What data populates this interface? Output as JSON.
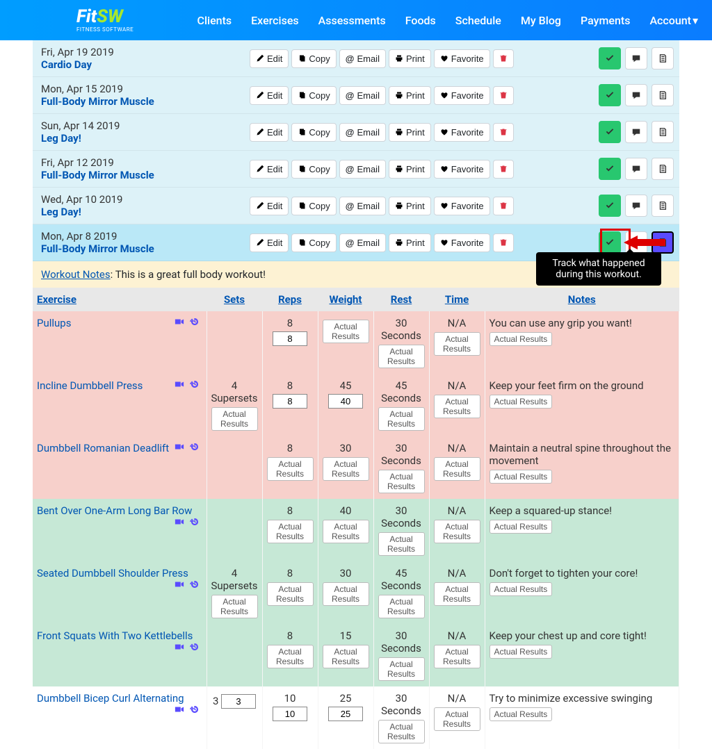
{
  "logo": {
    "fit": "Fit",
    "sw": "SW",
    "sub": "FITNESS SOFTWARE"
  },
  "nav": [
    "Clients",
    "Exercises",
    "Assessments",
    "Foods",
    "Schedule",
    "My Blog",
    "Payments",
    "Account"
  ],
  "actions": {
    "edit": "Edit",
    "copy": "Copy",
    "email": "Email",
    "print": "Print",
    "favorite": "Favorite",
    "actual_results": "Actual Results"
  },
  "tooltip": "Track what happened during this workout.",
  "workouts": [
    {
      "date": "Fri, Apr 19 2019",
      "name": "Cardio Day"
    },
    {
      "date": "Mon, Apr 15 2019",
      "name": "Full-Body Mirror Muscle"
    },
    {
      "date": "Sun, Apr 14 2019",
      "name": "Leg Day!"
    },
    {
      "date": "Fri, Apr 12 2019",
      "name": "Full-Body Mirror Muscle"
    },
    {
      "date": "Wed, Apr 10 2019",
      "name": "Leg Day!"
    },
    {
      "date": "Mon, Apr 8 2019",
      "name": "Full-Body Mirror Muscle"
    }
  ],
  "notes_label": "Workout Notes",
  "notes_text": ": This is a great full body workout!",
  "headers": {
    "exercise": "Exercise",
    "sets": "Sets",
    "reps": "Reps",
    "weight": "Weight",
    "rest": "Rest",
    "time": "Time",
    "notes": "Notes"
  },
  "exercises": [
    {
      "group": "pink",
      "name": "Pullups",
      "sets": "",
      "sets_sub": "",
      "sets_ar": false,
      "reps": "8",
      "reps_input": "8",
      "weight": "",
      "weight_input": "",
      "weight_ar": true,
      "rest": "30",
      "rest_sub": "Seconds",
      "time": "N/A",
      "notes": "You can use any grip you want!"
    },
    {
      "group": "pink",
      "name": "Incline Dumbbell Press",
      "sets": "4",
      "sets_sub": "Supersets",
      "sets_ar": true,
      "reps": "8",
      "reps_input": "8",
      "weight": "45",
      "weight_input": "40",
      "weight_ar": false,
      "rest": "45",
      "rest_sub": "Seconds",
      "time": "N/A",
      "notes": "Keep your feet firm on the ground"
    },
    {
      "group": "pink",
      "name": "Dumbbell Romanian Deadlift",
      "sets": "",
      "sets_sub": "",
      "sets_ar": false,
      "reps": "8",
      "reps_input": "",
      "reps_ar": true,
      "weight": "30",
      "weight_input": "",
      "weight_ar": true,
      "rest": "30",
      "rest_sub": "Seconds",
      "time": "N/A",
      "notes": "Maintain a neutral spine throughout the movement"
    },
    {
      "group": "green",
      "name": "Bent Over One-Arm Long Bar Row",
      "sets": "",
      "sets_sub": "",
      "sets_ar": false,
      "reps": "8",
      "reps_input": "",
      "reps_ar": true,
      "weight": "40",
      "weight_input": "",
      "weight_ar": true,
      "rest": "30",
      "rest_sub": "Seconds",
      "time": "N/A",
      "notes": "Keep a squared-up stance!"
    },
    {
      "group": "green",
      "name": "Seated Dumbbell Shoulder Press",
      "sets": "4",
      "sets_sub": "Supersets",
      "sets_ar": true,
      "reps": "8",
      "reps_input": "",
      "reps_ar": true,
      "weight": "30",
      "weight_input": "",
      "weight_ar": true,
      "rest": "45",
      "rest_sub": "Seconds",
      "time": "N/A",
      "notes": "Don't forget to tighten your core!"
    },
    {
      "group": "green",
      "name": "Front Squats With Two Kettlebells",
      "sets": "",
      "sets_sub": "",
      "sets_ar": false,
      "reps": "8",
      "reps_input": "",
      "reps_ar": true,
      "weight": "15",
      "weight_input": "",
      "weight_ar": true,
      "rest": "30",
      "rest_sub": "Seconds",
      "time": "N/A",
      "notes": "Keep your chest up and core tight!"
    },
    {
      "group": "",
      "name": "Dumbbell Bicep Curl Alternating",
      "sets": "3",
      "sets_sub": "",
      "sets_input": "3",
      "sets_ar": false,
      "reps": "10",
      "reps_input": "10",
      "weight": "25",
      "weight_input": "25",
      "weight_ar": false,
      "rest": "30",
      "rest_sub": "Seconds",
      "time": "N/A",
      "notes": "Try to minimize excessive swinging"
    }
  ]
}
